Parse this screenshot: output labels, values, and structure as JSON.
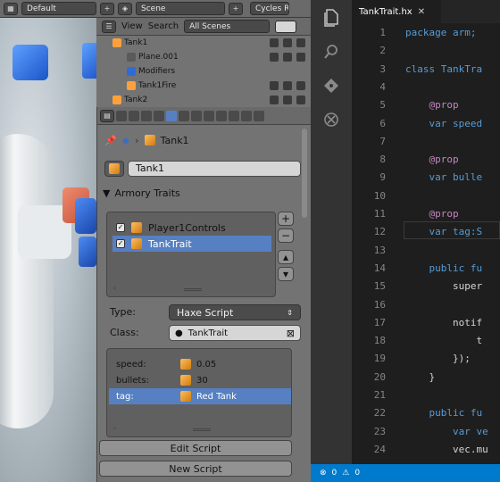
{
  "blender": {
    "top_header": {
      "layout_name": "Default",
      "scene_name": "Scene",
      "engine": "Cycles Re"
    },
    "outliner": {
      "menu": [
        "View",
        "Search"
      ],
      "display_mode": "All Scenes",
      "rows": [
        {
          "label": "Tank1"
        },
        {
          "label": "Plane.001"
        },
        {
          "label": "Modifiers"
        },
        {
          "label": "Tank1Fire"
        },
        {
          "label": "Tank2"
        }
      ]
    },
    "properties": {
      "breadcrumb": "Tank1",
      "object_name": "Tank1",
      "section_title": "Armory Traits",
      "traits": [
        {
          "label": "Player1Controls",
          "checked": true,
          "selected": false
        },
        {
          "label": "TankTrait",
          "checked": true,
          "selected": true
        }
      ],
      "type_label": "Type:",
      "type_value": "Haxe Script",
      "class_label": "Class:",
      "class_value": "TankTrait",
      "props": [
        {
          "key": "speed:",
          "value": "0.05"
        },
        {
          "key": "bullets:",
          "value": "30"
        },
        {
          "key": "tag:",
          "value": "Red Tank"
        }
      ],
      "edit_script_label": "Edit Script",
      "new_script_label": "New Script"
    }
  },
  "vscode": {
    "tab_title": "TankTrait.hx",
    "lines": [
      {
        "n": "1",
        "t": "package arm;"
      },
      {
        "n": "2",
        "t": ""
      },
      {
        "n": "3",
        "t": "class TankTra"
      },
      {
        "n": "4",
        "t": ""
      },
      {
        "n": "5",
        "t": "    @prop"
      },
      {
        "n": "6",
        "t": "    var speed"
      },
      {
        "n": "7",
        "t": ""
      },
      {
        "n": "8",
        "t": "    @prop"
      },
      {
        "n": "9",
        "t": "    var bulle"
      },
      {
        "n": "10",
        "t": ""
      },
      {
        "n": "11",
        "t": "    @prop"
      },
      {
        "n": "12",
        "t": "    var tag:S"
      },
      {
        "n": "13",
        "t": ""
      },
      {
        "n": "14",
        "t": "    public fu"
      },
      {
        "n": "15",
        "t": "        super"
      },
      {
        "n": "16",
        "t": ""
      },
      {
        "n": "17",
        "t": "        notif"
      },
      {
        "n": "18",
        "t": "            t"
      },
      {
        "n": "19",
        "t": "        });"
      },
      {
        "n": "20",
        "t": "    }"
      },
      {
        "n": "21",
        "t": ""
      },
      {
        "n": "22",
        "t": "    public fu"
      },
      {
        "n": "23",
        "t": "        var ve"
      },
      {
        "n": "24",
        "t": "        vec.mu"
      }
    ],
    "status_errors": "0",
    "status_warnings": "0"
  },
  "colors": {
    "selection": "#5680c2",
    "vscode_status": "#007acc",
    "keyword": "#569cd6",
    "decorator": "#c586c0"
  }
}
